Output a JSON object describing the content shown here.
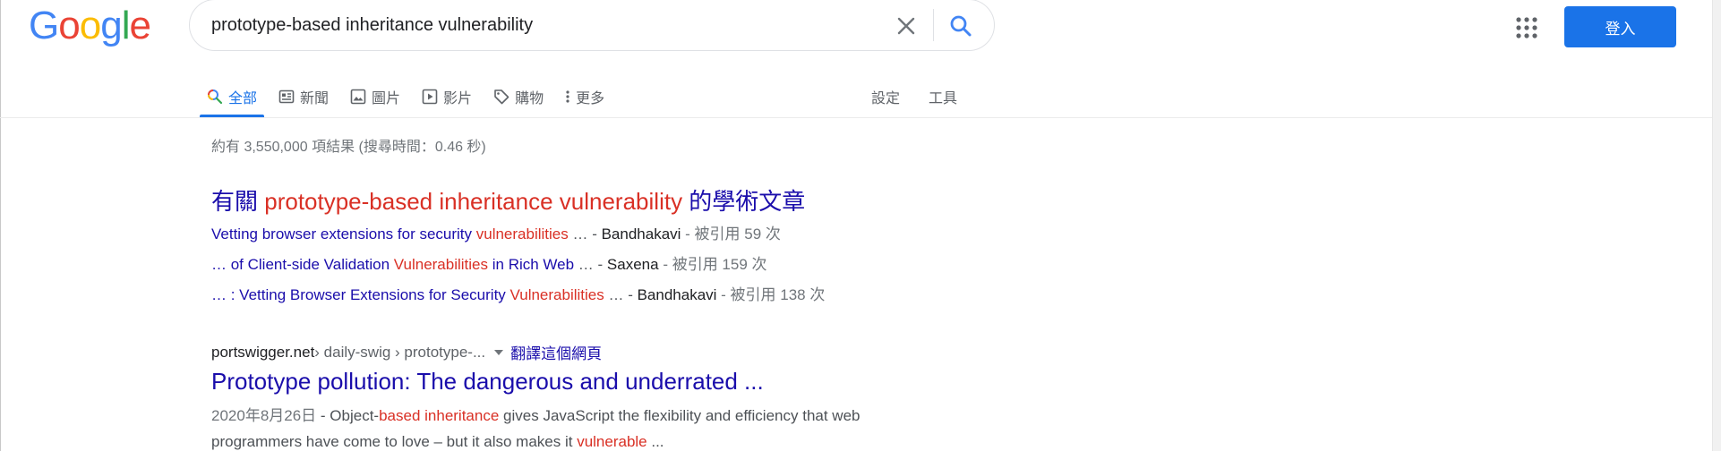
{
  "header": {
    "logo_letters": [
      "G",
      "o",
      "o",
      "g",
      "l",
      "e"
    ],
    "search": {
      "value": "prototype-based inheritance vulnerability"
    },
    "signin_label": "登入"
  },
  "tabs": [
    {
      "label": "全部",
      "icon": "search-icon",
      "active": true
    },
    {
      "label": "新聞",
      "icon": "news-icon",
      "active": false
    },
    {
      "label": "圖片",
      "icon": "image-icon",
      "active": false
    },
    {
      "label": "影片",
      "icon": "video-icon",
      "active": false
    },
    {
      "label": "購物",
      "icon": "tag-icon",
      "active": false
    },
    {
      "label": "更多",
      "icon": "more-vert-icon",
      "active": false
    }
  ],
  "tools": {
    "settings": "設定",
    "tools": "工具"
  },
  "stats": "約有 3,550,000 項結果 (搜尋時間：0.46 秒)",
  "scholar": {
    "title_prefix": "有關 ",
    "title_query": "prototype-based inheritance vulnerability",
    "title_suffix": " 的學術文章",
    "rows": [
      {
        "link_a": "Vetting browser extensions for security ",
        "hl": "vulnerabilities",
        "link_b": "",
        "rest": " … - ",
        "author": "Bandhakavi",
        "cites": " - 被引用 59 次"
      },
      {
        "link_a": "… of Client-side Validation ",
        "hl": "Vulnerabilities",
        "link_b": " in Rich Web",
        "rest": " … - ",
        "author": "Saxena",
        "cites": " - 被引用 159 次"
      },
      {
        "link_a": "… : Vetting Browser Extensions for Security ",
        "hl": "Vulnerabilities",
        "link_b": "",
        "rest": " … - ",
        "author": "Bandhakavi",
        "cites": " - 被引用 138 次"
      }
    ]
  },
  "result1": {
    "domain": "portswigger.net",
    "path": " › daily-swig › prototype-...",
    "translate": "翻譯這個網頁",
    "title": "Prototype pollution: The dangerous and underrated ...",
    "date": "2020年8月26日",
    "snippet_1": " - Object-",
    "snippet_hl1": "based inheritance",
    "snippet_2": " gives JavaScript the flexibility and efficiency that web programmers have come to love – but it also makes it ",
    "snippet_hl2": "vulnerable",
    "snippet_3": " ..."
  },
  "colors": {
    "accent": "#1a73e8",
    "link": "#1a0dab",
    "highlight": "#d93025"
  }
}
